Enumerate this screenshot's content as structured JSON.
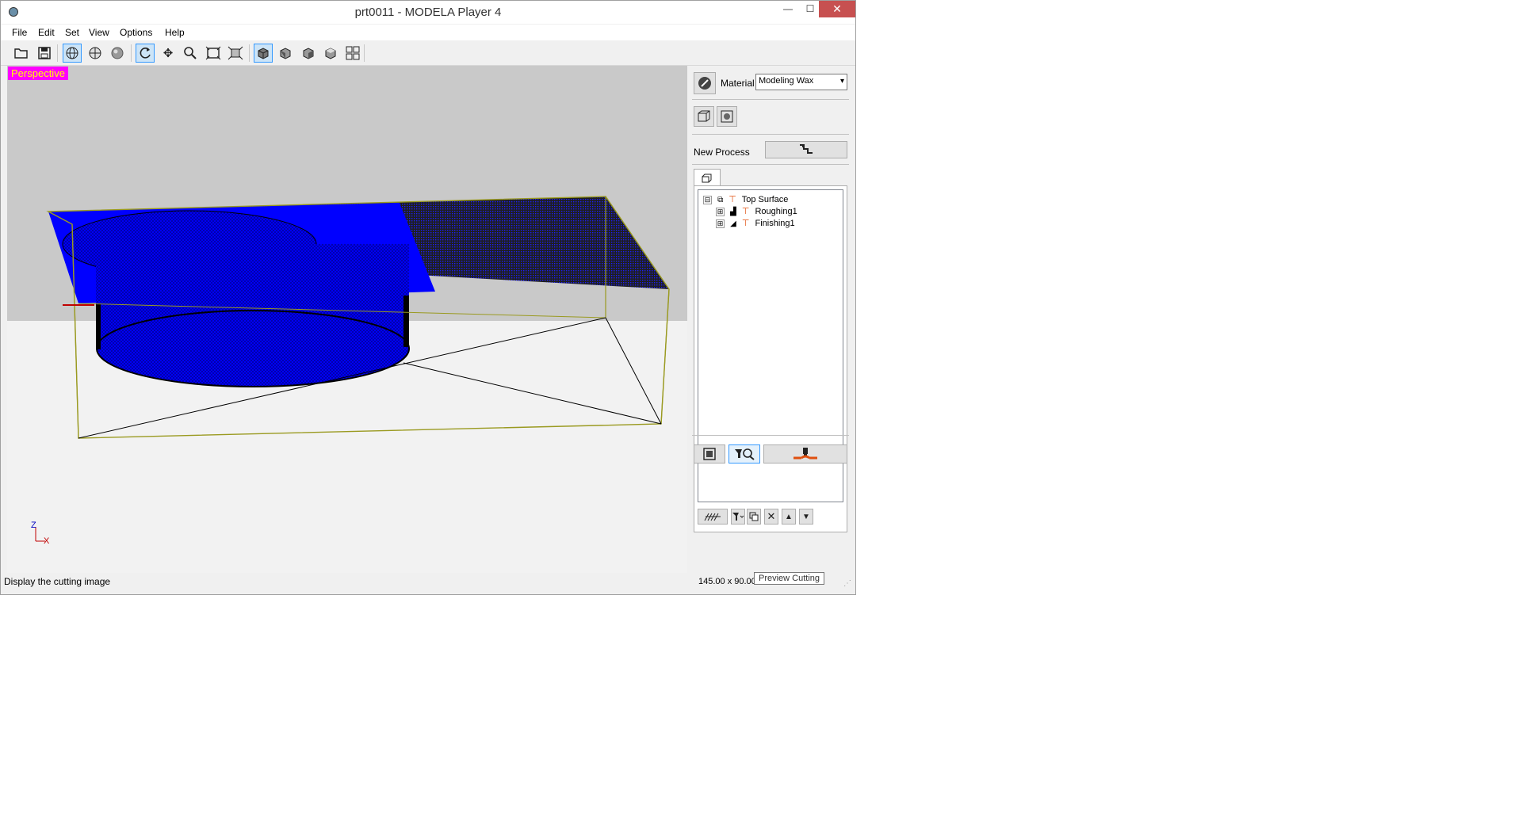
{
  "window": {
    "title": "prt0011 - MODELA Player 4",
    "controls": {
      "minimize": "—",
      "maximize": "☐",
      "close": "✕"
    }
  },
  "menu": [
    {
      "label": "File"
    },
    {
      "label": "Edit"
    },
    {
      "label": "Set"
    },
    {
      "label": "View"
    },
    {
      "label": "Options"
    },
    {
      "label": "Help"
    }
  ],
  "toolbar": {
    "icons": [
      "open-folder-icon",
      "save-icon",
      "wireframe-icon",
      "surface-icon",
      "shaded-icon",
      "rotate-icon",
      "move-icon",
      "zoom-icon",
      "fit-window-icon",
      "zoom-area-icon",
      "view-perspective-icon",
      "view-front-icon",
      "view-right-icon",
      "view-top-icon",
      "view-multi-icon"
    ]
  },
  "viewport": {
    "view_label": "Perspective",
    "axis_z": "Z",
    "axis_x": "X"
  },
  "panel": {
    "material_label": "Material",
    "material_value": "Modeling Wax",
    "new_process_label": "New Process",
    "tree": [
      {
        "label": "Top Surface",
        "expander": "⊟",
        "icon": "surface-tool-icon"
      },
      {
        "label": "Roughing1",
        "expander": "⊞",
        "icon": "roughing-icon"
      },
      {
        "label": "Finishing1",
        "expander": "⊞",
        "icon": "finishing-icon"
      }
    ]
  },
  "status": {
    "text": "Display the cutting image",
    "dimensions": "145.00 x 90.00"
  },
  "tooltip": "Preview Cutting",
  "colors": {
    "model_blue": "#0000ff",
    "bbox_olive": "#9a9a20",
    "perspective_bg": "#ff00ff",
    "perspective_fg": "#ffff00",
    "close_red": "#c75050"
  }
}
